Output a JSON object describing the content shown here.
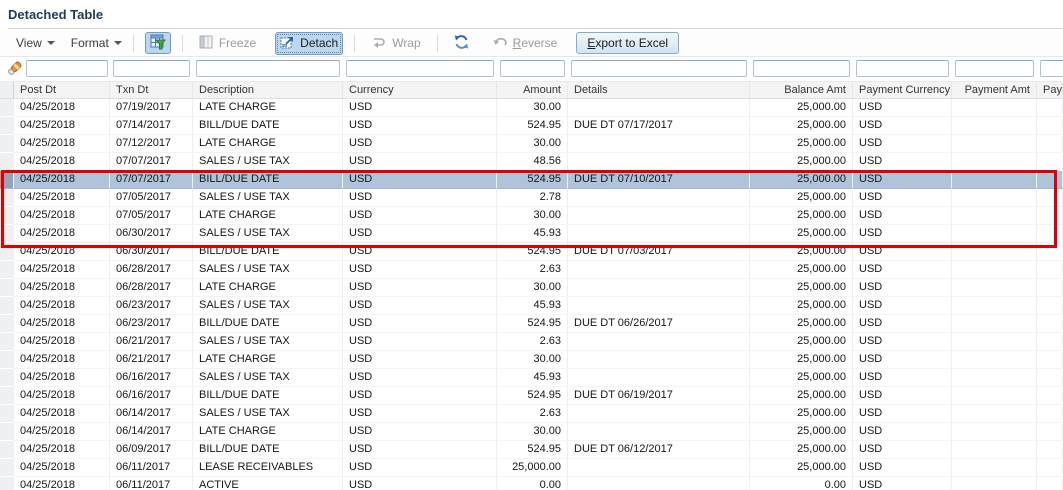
{
  "title": "Detached Table",
  "toolbar": {
    "view_label": "View",
    "format_label": "Format",
    "freeze_label": "Freeze",
    "detach_label": "Detach",
    "wrap_label": "Wrap",
    "reverse_label": "Reverse",
    "export_label": "Export to Excel",
    "icons": {
      "qbe_filter": "filter-table-icon",
      "freeze": "freeze-columns-icon",
      "detach": "detach-window-icon",
      "wrap": "wrap-text-icon",
      "refresh": "refresh-icon",
      "reverse": "reverse-icon",
      "filter_row": "eraser-pencil-icon"
    }
  },
  "filters": {
    "values": [
      "",
      "",
      "",
      "",
      "",
      "",
      "",
      "",
      "",
      ""
    ],
    "focused_column": "description"
  },
  "colors": {
    "title_text": "#1f3a5f",
    "selected_row_bg": "#afc4db",
    "selected_row_header_bg": "#94a5ba",
    "highlight_border": "#e10000",
    "toolbar_active_bg": "#bcd6ef"
  },
  "table": {
    "columns": [
      "Post Dt",
      "Txn Dt",
      "Description",
      "Currency",
      "Amount",
      "Details",
      "Balance Amt",
      "Payment Currency",
      "Payment Amt",
      "Payment"
    ],
    "selected_row_index": 4,
    "highlight_rows_from": 4,
    "highlight_rows_to": 7,
    "rows": [
      {
        "post_dt": "04/25/2018",
        "txn_dt": "07/19/2017",
        "description": "LATE CHARGE",
        "currency": "USD",
        "amount": "30.00",
        "details": "",
        "balance_amt": "25,000.00",
        "payment_currency": "USD",
        "payment_amt": "",
        "extra": ""
      },
      {
        "post_dt": "04/25/2018",
        "txn_dt": "07/14/2017",
        "description": "BILL/DUE DATE",
        "currency": "USD",
        "amount": "524.95",
        "details": "DUE DT 07/17/2017",
        "balance_amt": "25,000.00",
        "payment_currency": "USD",
        "payment_amt": "",
        "extra": ""
      },
      {
        "post_dt": "04/25/2018",
        "txn_dt": "07/12/2017",
        "description": "LATE CHARGE",
        "currency": "USD",
        "amount": "30.00",
        "details": "",
        "balance_amt": "25,000.00",
        "payment_currency": "USD",
        "payment_amt": "",
        "extra": ""
      },
      {
        "post_dt": "04/25/2018",
        "txn_dt": "07/07/2017",
        "description": "SALES / USE TAX",
        "currency": "USD",
        "amount": "48.56",
        "details": "",
        "balance_amt": "25,000.00",
        "payment_currency": "USD",
        "payment_amt": "",
        "extra": ""
      },
      {
        "post_dt": "04/25/2018",
        "txn_dt": "07/07/2017",
        "description": "BILL/DUE DATE",
        "currency": "USD",
        "amount": "524.95",
        "details": "DUE DT 07/10/2017",
        "balance_amt": "25,000.00",
        "payment_currency": "USD",
        "payment_amt": "",
        "extra": ""
      },
      {
        "post_dt": "04/25/2018",
        "txn_dt": "07/05/2017",
        "description": "SALES / USE TAX",
        "currency": "USD",
        "amount": "2.78",
        "details": "",
        "balance_amt": "25,000.00",
        "payment_currency": "USD",
        "payment_amt": "",
        "extra": ""
      },
      {
        "post_dt": "04/25/2018",
        "txn_dt": "07/05/2017",
        "description": "LATE CHARGE",
        "currency": "USD",
        "amount": "30.00",
        "details": "",
        "balance_amt": "25,000.00",
        "payment_currency": "USD",
        "payment_amt": "",
        "extra": ""
      },
      {
        "post_dt": "04/25/2018",
        "txn_dt": "06/30/2017",
        "description": "SALES / USE TAX",
        "currency": "USD",
        "amount": "45.93",
        "details": "",
        "balance_amt": "25,000.00",
        "payment_currency": "USD",
        "payment_amt": "",
        "extra": ""
      },
      {
        "post_dt": "04/25/2018",
        "txn_dt": "06/30/2017",
        "description": "BILL/DUE DATE",
        "currency": "USD",
        "amount": "524.95",
        "details": "DUE DT 07/03/2017",
        "balance_amt": "25,000.00",
        "payment_currency": "USD",
        "payment_amt": "",
        "extra": ""
      },
      {
        "post_dt": "04/25/2018",
        "txn_dt": "06/28/2017",
        "description": "SALES / USE TAX",
        "currency": "USD",
        "amount": "2.63",
        "details": "",
        "balance_amt": "25,000.00",
        "payment_currency": "USD",
        "payment_amt": "",
        "extra": ""
      },
      {
        "post_dt": "04/25/2018",
        "txn_dt": "06/28/2017",
        "description": "LATE CHARGE",
        "currency": "USD",
        "amount": "30.00",
        "details": "",
        "balance_amt": "25,000.00",
        "payment_currency": "USD",
        "payment_amt": "",
        "extra": ""
      },
      {
        "post_dt": "04/25/2018",
        "txn_dt": "06/23/2017",
        "description": "SALES / USE TAX",
        "currency": "USD",
        "amount": "45.93",
        "details": "",
        "balance_amt": "25,000.00",
        "payment_currency": "USD",
        "payment_amt": "",
        "extra": ""
      },
      {
        "post_dt": "04/25/2018",
        "txn_dt": "06/23/2017",
        "description": "BILL/DUE DATE",
        "currency": "USD",
        "amount": "524.95",
        "details": "DUE DT 06/26/2017",
        "balance_amt": "25,000.00",
        "payment_currency": "USD",
        "payment_amt": "",
        "extra": ""
      },
      {
        "post_dt": "04/25/2018",
        "txn_dt": "06/21/2017",
        "description": "SALES / USE TAX",
        "currency": "USD",
        "amount": "2.63",
        "details": "",
        "balance_amt": "25,000.00",
        "payment_currency": "USD",
        "payment_amt": "",
        "extra": ""
      },
      {
        "post_dt": "04/25/2018",
        "txn_dt": "06/21/2017",
        "description": "LATE CHARGE",
        "currency": "USD",
        "amount": "30.00",
        "details": "",
        "balance_amt": "25,000.00",
        "payment_currency": "USD",
        "payment_amt": "",
        "extra": ""
      },
      {
        "post_dt": "04/25/2018",
        "txn_dt": "06/16/2017",
        "description": "SALES / USE TAX",
        "currency": "USD",
        "amount": "45.93",
        "details": "",
        "balance_amt": "25,000.00",
        "payment_currency": "USD",
        "payment_amt": "",
        "extra": ""
      },
      {
        "post_dt": "04/25/2018",
        "txn_dt": "06/16/2017",
        "description": "BILL/DUE DATE",
        "currency": "USD",
        "amount": "524.95",
        "details": "DUE DT 06/19/2017",
        "balance_amt": "25,000.00",
        "payment_currency": "USD",
        "payment_amt": "",
        "extra": ""
      },
      {
        "post_dt": "04/25/2018",
        "txn_dt": "06/14/2017",
        "description": "SALES / USE TAX",
        "currency": "USD",
        "amount": "2.63",
        "details": "",
        "balance_amt": "25,000.00",
        "payment_currency": "USD",
        "payment_amt": "",
        "extra": ""
      },
      {
        "post_dt": "04/25/2018",
        "txn_dt": "06/14/2017",
        "description": "LATE CHARGE",
        "currency": "USD",
        "amount": "30.00",
        "details": "",
        "balance_amt": "25,000.00",
        "payment_currency": "USD",
        "payment_amt": "",
        "extra": ""
      },
      {
        "post_dt": "04/25/2018",
        "txn_dt": "06/09/2017",
        "description": "BILL/DUE DATE",
        "currency": "USD",
        "amount": "524.95",
        "details": "DUE DT 06/12/2017",
        "balance_amt": "25,000.00",
        "payment_currency": "USD",
        "payment_amt": "",
        "extra": ""
      },
      {
        "post_dt": "04/25/2018",
        "txn_dt": "06/11/2017",
        "description": "LEASE RECEIVABLES",
        "currency": "USD",
        "amount": "25,000.00",
        "details": "",
        "balance_amt": "25,000.00",
        "payment_currency": "USD",
        "payment_amt": "",
        "extra": ""
      },
      {
        "post_dt": "04/25/2018",
        "txn_dt": "06/11/2017",
        "description": "ACTIVE",
        "currency": "USD",
        "amount": "0.00",
        "details": "",
        "balance_amt": "0.00",
        "payment_currency": "USD",
        "payment_amt": "",
        "extra": ""
      }
    ]
  }
}
